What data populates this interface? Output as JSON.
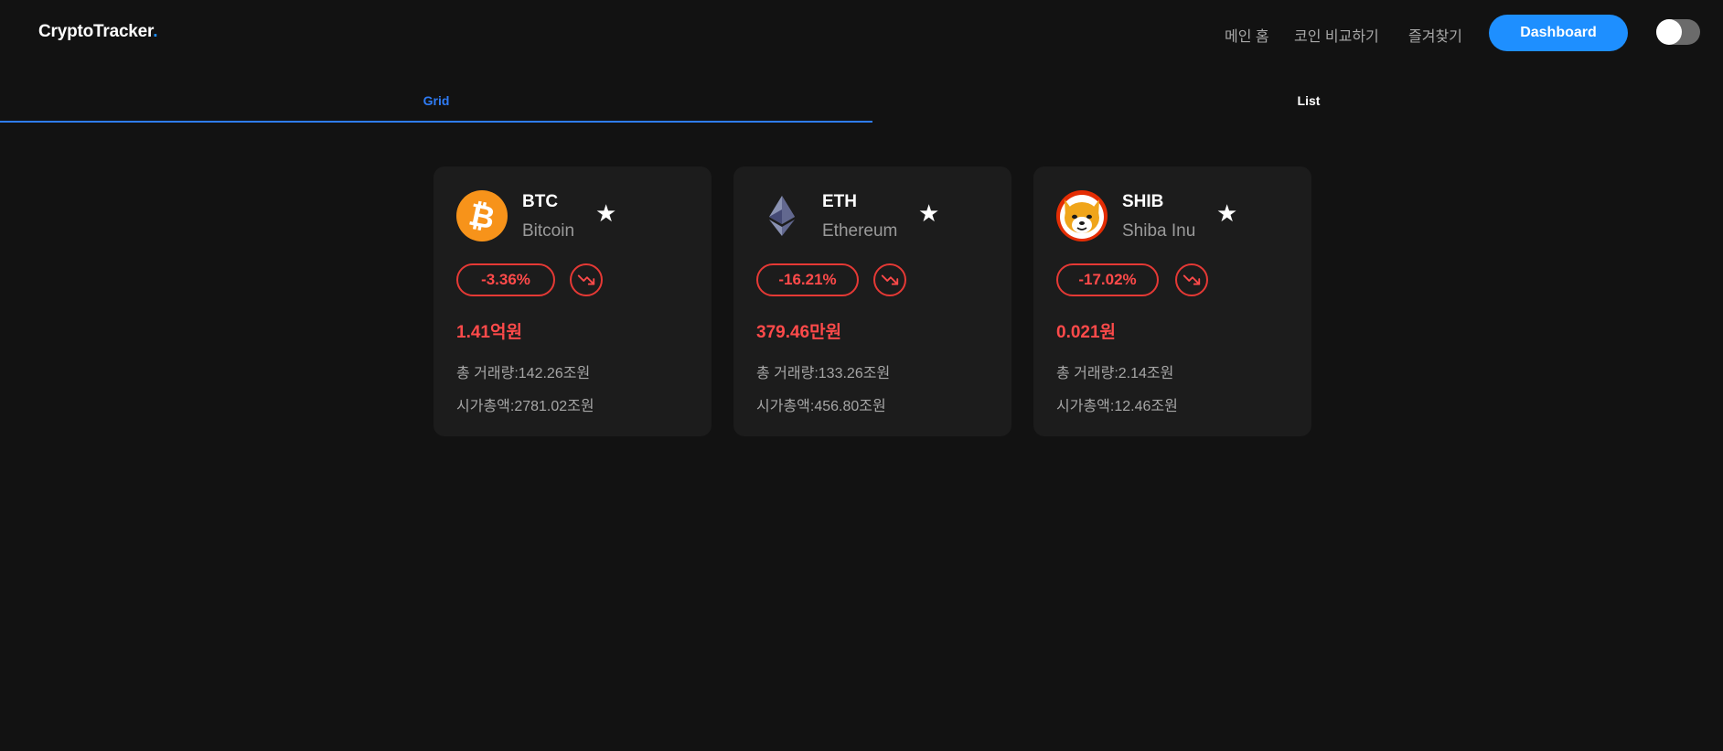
{
  "header": {
    "logo_text": "CryptoTracker",
    "logo_dot": ".",
    "nav": [
      "메인 홈",
      "코인 비교하기",
      "즐겨찾기"
    ],
    "dashboard_label": "Dashboard"
  },
  "tabs": [
    {
      "label": "Grid",
      "active": true
    },
    {
      "label": "List",
      "active": false
    }
  ],
  "accent_color": "#1e8fff",
  "negative_color": "#ff4a4a",
  "coins": [
    {
      "symbol": "BTC",
      "name": "Bitcoin",
      "change": "-3.36%",
      "price": "1.41억원",
      "volume_label": "총 거래량:",
      "volume": "142.26조원",
      "cap_label": "시가총액:",
      "cap": "2781.02조원",
      "icon": "bitcoin-icon"
    },
    {
      "symbol": "ETH",
      "name": "Ethereum",
      "change": "-16.21%",
      "price": "379.46만원",
      "volume_label": "총 거래량:",
      "volume": "133.26조원",
      "cap_label": "시가총액:",
      "cap": "456.80조원",
      "icon": "ethereum-icon"
    },
    {
      "symbol": "SHIB",
      "name": "Shiba Inu",
      "change": "-17.02%",
      "price": "0.021원",
      "volume_label": "총 거래량:",
      "volume": "2.14조원",
      "cap_label": "시가총액:",
      "cap": "12.46조원",
      "icon": "shiba-inu-icon"
    }
  ]
}
